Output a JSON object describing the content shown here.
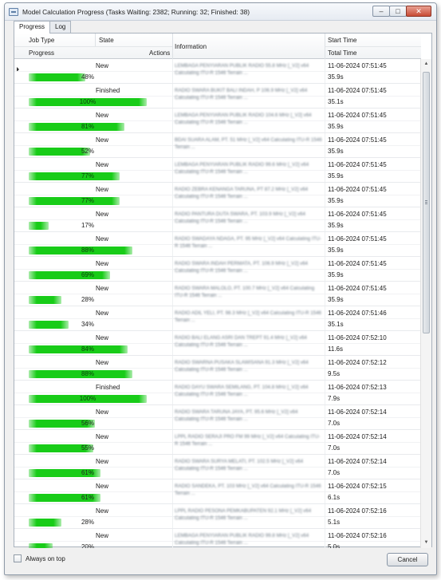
{
  "window": {
    "title": "Model Calculation Progress (Tasks Waiting: 2382; Running: 32; Finished: 38)",
    "controls": {
      "minimize": "–",
      "maximize": "□",
      "close": "✕"
    }
  },
  "tabs": [
    {
      "label": "Progress"
    },
    {
      "label": "Log"
    }
  ],
  "columns": {
    "job_type": "Job Type",
    "state": "State",
    "progress": "Progress",
    "actions": "Actions",
    "information": "Information",
    "start_time": "Start Time",
    "total_time": "Total Time"
  },
  "rows": [
    {
      "state": "New",
      "progress": 48,
      "pct_label": "48%",
      "info": "LEMBAGA PENYIARAN PUBLIK RADIO 55.8 MHz [_V2] v64 Calculating ITU-R 1546 Terrain ...",
      "start": "11-06-2024 07:51:45",
      "total": "35.9s"
    },
    {
      "state": "Finished",
      "progress": 100,
      "pct_label": "100%",
      "info": "RADIO SWARA BUKIT BALI INDAH, P 106.9 MHz [_V2] v64 Calculating ITU-R 1546 Terrain ...",
      "start": "11-06-2024 07:51:45",
      "total": "35.1s"
    },
    {
      "state": "New",
      "progress": 81,
      "pct_label": "81%",
      "info": "LEMBAGA PENYIARAN PUBLIK RADIO 104.6 MHz [_V2] v64 Calculating ITU-R 1546 Terrain ...",
      "start": "11-06-2024 07:51:45",
      "total": "35.9s"
    },
    {
      "state": "New",
      "progress": 52,
      "pct_label": "52%",
      "info": "BDAI SUARA ALAM, PT. 51 MHz [_V2] v64 Calculating ITU-R 1546 Terrain ...",
      "start": "11-06-2024 07:51:45",
      "total": "35.9s"
    },
    {
      "state": "New",
      "progress": 77,
      "pct_label": "77%",
      "info": "LEMBAGA PENYIARAN PUBLIK RADIO 99.6 MHz [_V2] v64 Calculating ITU-R 1546 Terrain ...",
      "start": "11-06-2024 07:51:45",
      "total": "35.9s"
    },
    {
      "state": "New",
      "progress": 77,
      "pct_label": "77%",
      "info": "RADIO ZEBRA KENANGA TARUNA, PT 87.2 MHz [_V2] v64 Calculating ITU-R 1546 Terrain ...",
      "start": "11-06-2024 07:51:45",
      "total": "35.9s"
    },
    {
      "state": "New",
      "progress": 17,
      "pct_label": "17%",
      "info": "RADIO PANTURA DUTA SWARA, PT. 103.9 MHz [_V2] v64 Calculating ITU-R 1546 Terrain ...",
      "start": "11-06-2024 07:51:45",
      "total": "35.9s"
    },
    {
      "state": "New",
      "progress": 88,
      "pct_label": "88%",
      "info": "RADIO SWADAYA NDAGA, PT. 95 MHz [_V2] v64 Calculating ITU-R 1546 Terrain ...",
      "start": "11-06-2024 07:51:45",
      "total": "35.9s"
    },
    {
      "state": "New",
      "progress": 69,
      "pct_label": "69%",
      "info": "RADIO SWARA INDAH PERMATA, PT. 106.9 MHz [_V2] v64 Calculating ITU-R 1546 Terrain ...",
      "start": "11-06-2024 07:51:45",
      "total": "35.9s"
    },
    {
      "state": "New",
      "progress": 28,
      "pct_label": "28%",
      "info": "RADIO SWARA MALOLO, PT. 100.7 MHz [_V2] v64 Calculating ITU-R 1546 Terrain ...",
      "start": "11-06-2024 07:51:45",
      "total": "35.9s"
    },
    {
      "state": "New",
      "progress": 34,
      "pct_label": "34%",
      "info": "RADIO ADIL YELI, PT. 98.3 MHz [_V2] v64 Calculating ITU-R 1546 Terrain ...",
      "start": "11-06-2024 07:51:46",
      "total": "35.1s"
    },
    {
      "state": "New",
      "progress": 84,
      "pct_label": "84%",
      "info": "RADIO BALI ELANG ASRI DAN TREPT 91.4 MHz [_V2] v64 Calculating ITU-R 1546 Terrain ...",
      "start": "11-06-2024 07:52:10",
      "total": "11.6s"
    },
    {
      "state": "New",
      "progress": 88,
      "pct_label": "88%",
      "info": "RADIO SWARNA PUSAKA SLAWISANA 91.3 MHz [_V2] v64 Calculating ITU-R 1546 Terrain ...",
      "start": "11-06-2024 07:52:12",
      "total": "9.5s"
    },
    {
      "state": "Finished",
      "progress": 100,
      "pct_label": "100%",
      "info": "RADIO DAYU SWARA SEMILANG, PT. 104.8 MHz [_V2] v64 Calculating ITU-R 1546 Terrain ...",
      "start": "11-06-2024 07:52:13",
      "total": "7.9s"
    },
    {
      "state": "New",
      "progress": 56,
      "pct_label": "56%",
      "info": "RADIO SWARA TARUNA JAYA, PT. 95.6 MHz [_V2] v64 Calculating ITU-R 1546 Terrain ...",
      "start": "11-06-2024 07:52:14",
      "total": "7.0s"
    },
    {
      "state": "New",
      "progress": 55,
      "pct_label": "55%",
      "info": "LPPL RADIO SERAJI PRO FM 99 MHz [_V2] v64 Calculating ITU-R 1546 Terrain ...",
      "start": "11-06-2024 07:52:14",
      "total": "7.0s"
    },
    {
      "state": "New",
      "progress": 61,
      "pct_label": "61%",
      "info": "RADIO SWARA SURYA MELATI, PT. 102.5 MHz [_V2] v64 Calculating ITU-R 1546 Terrain ...",
      "start": "11-06-2024 07:52:14",
      "total": "7.0s"
    },
    {
      "state": "New",
      "progress": 61,
      "pct_label": "61%",
      "info": "RADIO SANDEKA, PT. 103 MHz [_V2] v64 Calculating ITU-R 1546 Terrain ...",
      "start": "11-06-2024 07:52:15",
      "total": "6.1s"
    },
    {
      "state": "New",
      "progress": 28,
      "pct_label": "28%",
      "info": "LPPL RADIO PESONA PEMKABUPATEN 92.1 MHz [_V2] v64 Calculating ITU-R 1546 Terrain ...",
      "start": "11-06-2024 07:52:16",
      "total": "5.1s"
    },
    {
      "state": "New",
      "progress": 20,
      "pct_label": "20%",
      "info": "LEMBAGA PENYIARAN PUBLIK RADIO 99.8 MHz [_V2] v64 Calculating ITU-R 1546 Terrain ...",
      "start": "11-06-2024 07:52:16",
      "total": "5.0s"
    }
  ],
  "scrollbar": {
    "up": "▲",
    "down": "▼"
  },
  "footer": {
    "always_on_top": "Always on top",
    "cancel": "Cancel"
  }
}
